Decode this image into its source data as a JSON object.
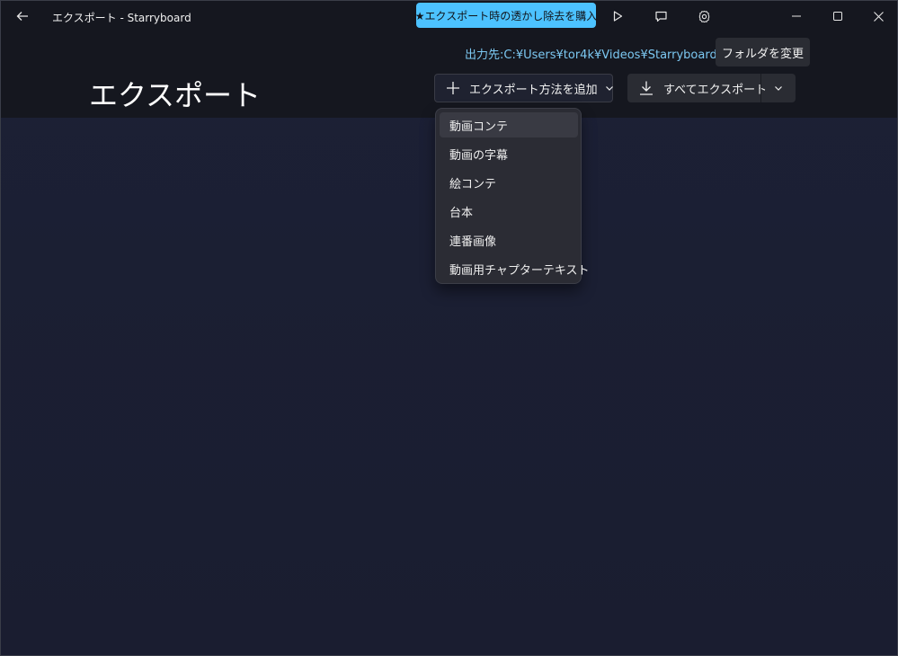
{
  "titlebar": {
    "app_title": "エクスポート - Starryboard",
    "promo_label": "★エクスポート時の透かし除去を購入",
    "icons": [
      "back-arrow-icon",
      "play-icon",
      "feedback-icon",
      "gear-icon",
      "minimize-icon",
      "maximize-icon",
      "close-icon"
    ]
  },
  "header": {
    "output_path": "出力先:C:¥Users¥tor4k¥Videos¥Starryboard",
    "change_folder_label": "フォルダを変更",
    "page_title": "エクスポート",
    "add_method_label": "エクスポート方法を追加",
    "export_all_label": "すべてエクスポート"
  },
  "menu": {
    "items": [
      {
        "label": "動画コンテ"
      },
      {
        "label": "動画の字幕"
      },
      {
        "label": "絵コンテ"
      },
      {
        "label": "台本"
      },
      {
        "label": "連番画像"
      },
      {
        "label": "動画用チャプターテキスト"
      }
    ]
  },
  "colors": {
    "accent": "#4cc2ff",
    "path_text": "#7cc8f2",
    "background": "#1b1f33",
    "header_bg": "#15171f"
  }
}
